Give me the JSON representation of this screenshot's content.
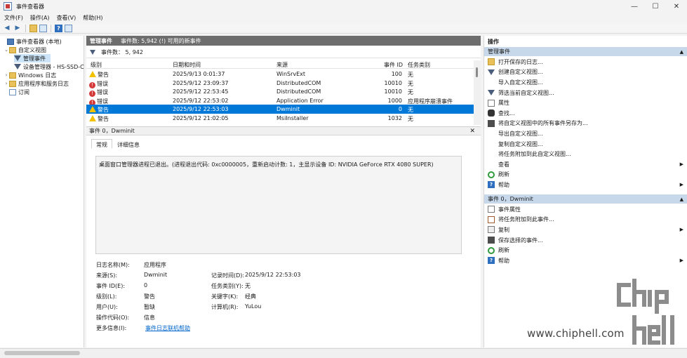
{
  "window": {
    "title": "事件查看器",
    "controls": [
      "—",
      "☐",
      "✕"
    ]
  },
  "menu": [
    "文件(F)",
    "操作(A)",
    "查看(V)",
    "帮助(H)"
  ],
  "tree": {
    "items": [
      {
        "label": "事件查看器 (本地)",
        "expander": "",
        "icon": "computer-icon",
        "indent": 0
      },
      {
        "label": "自定义视图",
        "expander": "⌄",
        "icon": "folder-icon",
        "indent": 1
      },
      {
        "label": "管理事件",
        "expander": "",
        "icon": "filter-icon",
        "indent": 2,
        "selected": true
      },
      {
        "label": "设备管理器 - HS-SSD-C",
        "expander": "",
        "icon": "filter-icon",
        "indent": 2
      },
      {
        "label": "Windows 日志",
        "expander": "›",
        "icon": "folder-icon",
        "indent": 1
      },
      {
        "label": "应用程序和服务日志",
        "expander": "›",
        "icon": "folder-icon",
        "indent": 1
      },
      {
        "label": "订阅",
        "expander": "",
        "icon": "log-icon",
        "indent": 1
      }
    ]
  },
  "center": {
    "header_title": "管理事件",
    "header_info": "事件数: 5,942 (!) 可用的新事件",
    "filter_text": "事件数： 5, 942",
    "columns": [
      "级别",
      "日期和时间",
      "来源",
      "事件 ID",
      "任务类别"
    ],
    "rows": [
      {
        "level": "警告",
        "type": "warn",
        "datetime": "2025/9/13 0:01:37",
        "source": "WinSrvExt",
        "id": "100",
        "task": "无"
      },
      {
        "level": "错误",
        "type": "err",
        "datetime": "2025/9/12 23:09:37",
        "source": "DistributedCOM",
        "id": "10010",
        "task": "无"
      },
      {
        "level": "错误",
        "type": "err",
        "datetime": "2025/9/12 22:53:45",
        "source": "DistributedCOM",
        "id": "10010",
        "task": "无"
      },
      {
        "level": "错误",
        "type": "err",
        "datetime": "2025/9/12 22:53:02",
        "source": "Application Error",
        "id": "1000",
        "task": "应用程序崩溃事件"
      },
      {
        "level": "警告",
        "type": "warn",
        "datetime": "2025/9/12 22:53:03",
        "source": "Dwminit",
        "id": "0",
        "task": "无",
        "selected": true
      },
      {
        "level": "警告",
        "type": "warn",
        "datetime": "2025/9/12 21:02:05",
        "source": "MsiInstaller",
        "id": "1032",
        "task": "无"
      }
    ],
    "detail_title": "事件 0，Dwminit",
    "tabs": [
      "常规",
      "详细信息"
    ],
    "description": "桌面窗口管理器进程已退出。(进程退出代码: 0xc0000005，重新启动计数: 1，主显示设备 ID: NVIDIA GeForce RTX 4080 SUPER)",
    "props_left": [
      {
        "label": "日志名称(M):",
        "value": "应用程序"
      },
      {
        "label": "来源(S):",
        "value": "Dwminit"
      },
      {
        "label": "事件 ID(E):",
        "value": "0"
      },
      {
        "label": "级别(L):",
        "value": "警告"
      },
      {
        "label": "用户(U):",
        "value": "暂缺"
      },
      {
        "label": "操作代码(O):",
        "value": "信息"
      },
      {
        "label": "更多信息(I):",
        "value": "事件日志联机帮助"
      }
    ],
    "props_right": [
      {
        "label": "记录时间(D):",
        "value": "2025/9/12 22:53:03"
      },
      {
        "label": "任务类别(Y):",
        "value": "无"
      },
      {
        "label": "关键字(K):",
        "value": "经典"
      },
      {
        "label": "计算机(R):",
        "value": "YuLou"
      }
    ]
  },
  "actions": {
    "title": "操作",
    "section1": "管理事件",
    "section1_items": [
      {
        "label": "打开保存的日志...",
        "icon": "open-icon",
        "arrow": false
      },
      {
        "label": "创建自定义视图...",
        "icon": "filter-icon",
        "arrow": false
      },
      {
        "label": "导入自定义视图...",
        "icon": "blank-icon",
        "arrow": false
      },
      {
        "label": "筛选当前自定义视图...",
        "icon": "filter-icon",
        "arrow": false
      },
      {
        "label": "属性",
        "icon": "doc-icon",
        "arrow": false
      },
      {
        "label": "查找...",
        "icon": "binoculars-icon",
        "arrow": false
      },
      {
        "label": "将自定义视图中的所有事件另存为...",
        "icon": "save-icon",
        "arrow": false
      },
      {
        "label": "导出自定义视图...",
        "icon": "blank-icon",
        "arrow": false
      },
      {
        "label": "复制自定义视图...",
        "icon": "blank-icon",
        "arrow": false
      },
      {
        "label": "将任务附加到此自定义视图...",
        "icon": "blank-icon",
        "arrow": false
      },
      {
        "label": "查看",
        "icon": "blank-icon",
        "arrow": true
      },
      {
        "label": "刷新",
        "icon": "refresh-icon",
        "arrow": false
      },
      {
        "label": "帮助",
        "icon": "help-icon",
        "arrow": true
      }
    ],
    "section2": "事件 0，Dwminit",
    "section2_items": [
      {
        "label": "事件属性",
        "icon": "doc-icon",
        "arrow": false
      },
      {
        "label": "将任务附加到此事件...",
        "icon": "task-icon",
        "arrow": false
      },
      {
        "label": "复制",
        "icon": "copy-icon",
        "arrow": true
      },
      {
        "label": "保存选择的事件...",
        "icon": "save-icon",
        "arrow": false
      },
      {
        "label": "刷新",
        "icon": "refresh-icon",
        "arrow": false
      },
      {
        "label": "帮助",
        "icon": "help-icon",
        "arrow": true
      }
    ]
  },
  "watermark": {
    "text": "www.chiphell.com",
    "logo_text": "chip hell"
  },
  "colors": {
    "selection": "#0078d7",
    "section_bg": "#c7d8ea",
    "header_bg": "#6d6d6d",
    "warn": "#f2c200",
    "error": "#d43a3a"
  }
}
